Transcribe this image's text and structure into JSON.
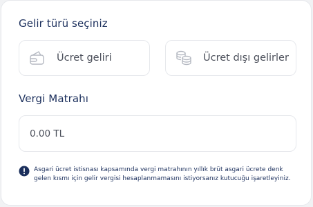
{
  "income_type": {
    "title": "Gelir türü seçiniz",
    "options": [
      {
        "label": "Ücret geliri",
        "icon": "wallet-icon"
      },
      {
        "label": "Ücret dışı gelirler",
        "icon": "coins-icon"
      }
    ]
  },
  "tax_base": {
    "title": "Vergi Matrahı",
    "placeholder": "0.00 TL"
  },
  "info": {
    "icon": "alert-icon",
    "text": "Asgari ücret istisnası kapsamında vergi matrahının yıllık brüt asgari ücrete denk gelen kısmı için gelir vergisi hesaplanmamasını istiyorsanız kutucuğu işaretleyiniz."
  },
  "colors": {
    "title": "#1b2f5c",
    "text": "#4b4f5a",
    "border": "#e6e8ec",
    "icon": "#b5b9c2"
  }
}
